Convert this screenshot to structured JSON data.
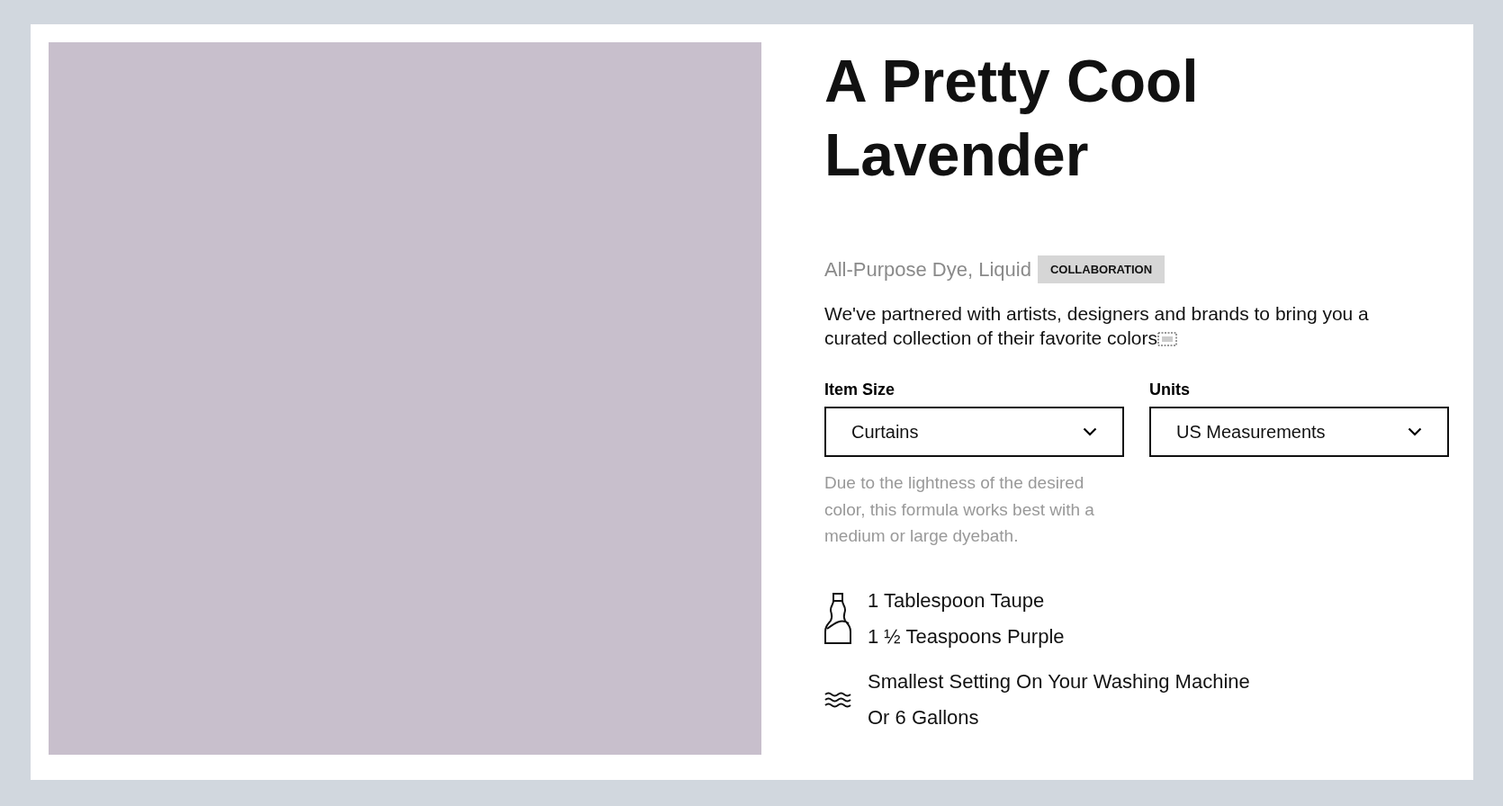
{
  "swatch": {
    "color": "#c8bfcc"
  },
  "title": "A Pretty Cool Lavender",
  "product_type": "All-Purpose Dye, Liquid",
  "badge": "COLLABORATION",
  "description": "We've partnered with artists, designers and brands to bring you a curated collection of their favorite colors",
  "selects": [
    {
      "label": "Item Size",
      "value": "Curtains"
    },
    {
      "label": "Units",
      "value": "US Measurements"
    }
  ],
  "note": "Due to the lightness of the desired color, this formula works best with a medium or large dyebath.",
  "instructions": [
    {
      "kind": "dye",
      "lines": [
        "1 Tablespoon Taupe",
        "1 ½ Teaspoons Purple"
      ]
    },
    {
      "kind": "water",
      "lines": [
        "Smallest Setting On Your Washing Machine",
        "Or 6 Gallons"
      ]
    }
  ]
}
